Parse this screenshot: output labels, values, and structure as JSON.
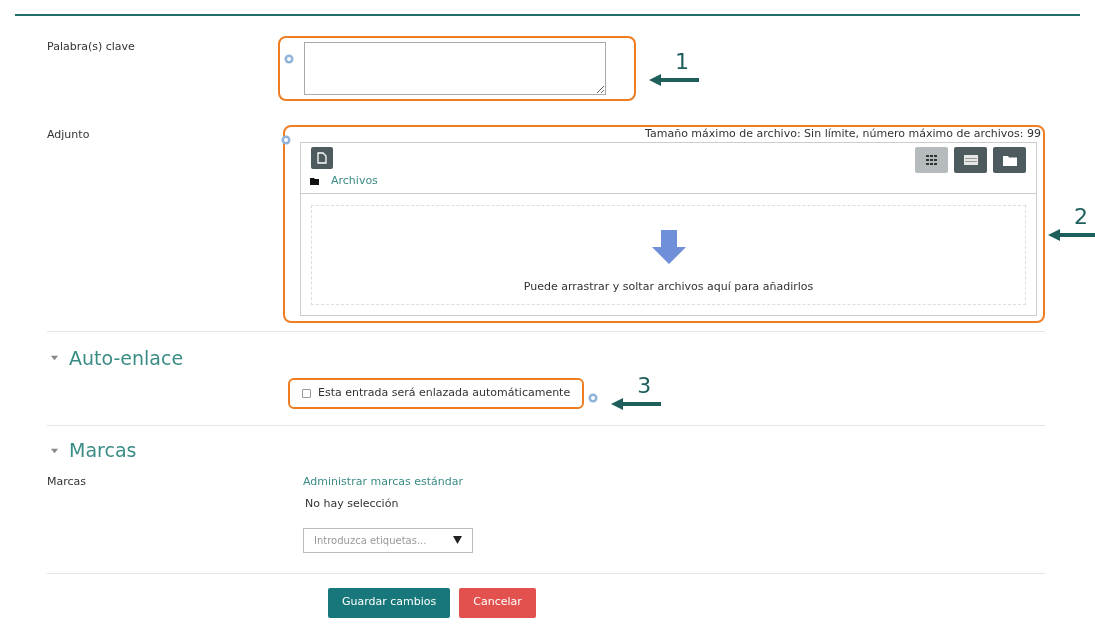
{
  "keywords": {
    "label": "Palabra(s) clave",
    "annotation": "1"
  },
  "attachment": {
    "label": "Adjunto",
    "limits": "Tamaño máximo de archivo: Sin límite, número máximo de archivos: 99",
    "annotation": "2",
    "path": "Archivos",
    "drop_text": "Puede arrastrar y soltar archivos aquí para añadirlos",
    "views": [
      {
        "kind": "icons",
        "selected": true
      },
      {
        "kind": "list",
        "selected": false
      },
      {
        "kind": "tree",
        "selected": false
      }
    ]
  },
  "autolink": {
    "title": "Auto-enlace",
    "expanded": true,
    "checkbox": {
      "label": "Esta entrada será enlazada automáticamente",
      "checked": false
    },
    "annotation": "3"
  },
  "tags": {
    "title": "Marcas",
    "expanded": true,
    "label": "Marcas",
    "manage_link": "Administrar marcas estándar",
    "selection": "No hay selección",
    "placeholder": "Introduzca etiquetas..."
  },
  "buttons": [
    {
      "label": "Guardar cambios",
      "kind": "primary"
    },
    {
      "label": "Cancelar",
      "kind": "danger"
    }
  ]
}
